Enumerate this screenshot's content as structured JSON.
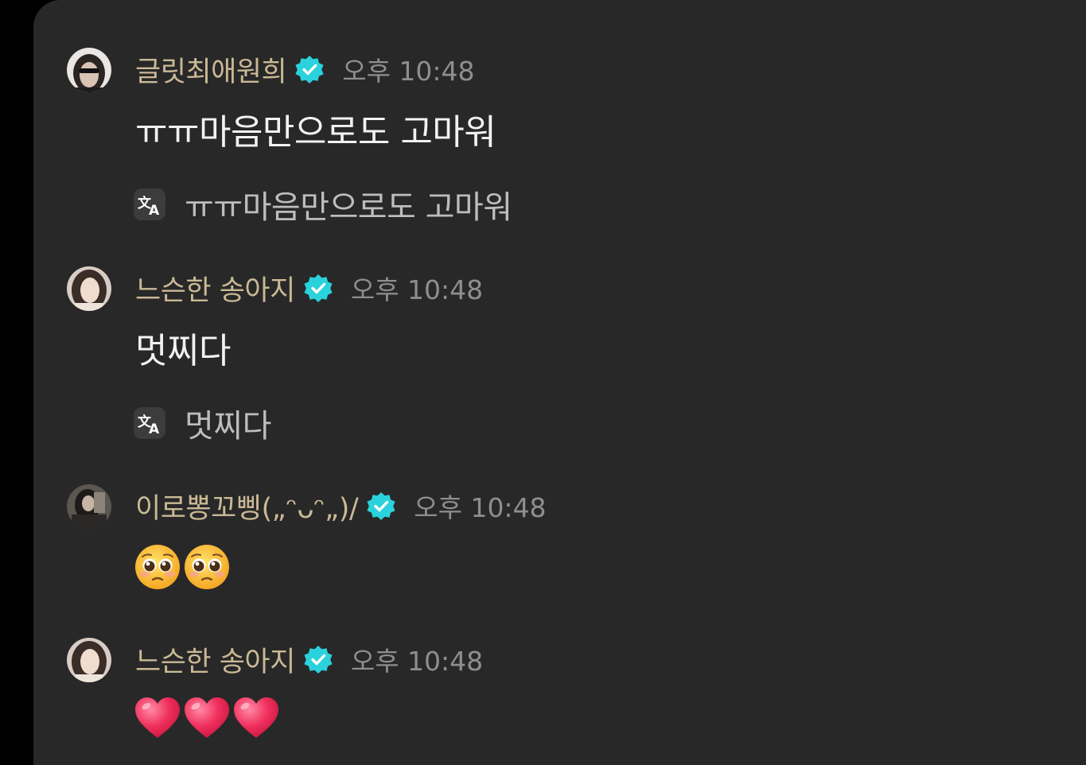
{
  "messages": [
    {
      "username": "글릿최애원희",
      "timestamp": "오후 10:48",
      "text": "ㅠㅠ마음만으로도 고마워",
      "translation": "ㅠㅠ마음만으로도 고마워"
    },
    {
      "username": "느슨한 송아지",
      "timestamp": "오후 10:48",
      "text": "멋찌다",
      "translation": "멋찌다"
    },
    {
      "username": "이로뽕꼬삥(„ᵔᴗᵔ„)/",
      "timestamp": "오후 10:48",
      "emojis": [
        "pleading-face",
        "pleading-face"
      ]
    },
    {
      "username": "느슨한 송아지",
      "timestamp": "오후 10:48",
      "emojis": [
        "red-heart",
        "red-heart",
        "red-heart"
      ]
    }
  ],
  "colors": {
    "background": "#282828",
    "username": "#c9b995",
    "timestamp": "#8e8e8e",
    "verified_badge": "#2ad2dc",
    "message_text": "#f2f2f2",
    "translation_text": "#bdbdbd"
  }
}
